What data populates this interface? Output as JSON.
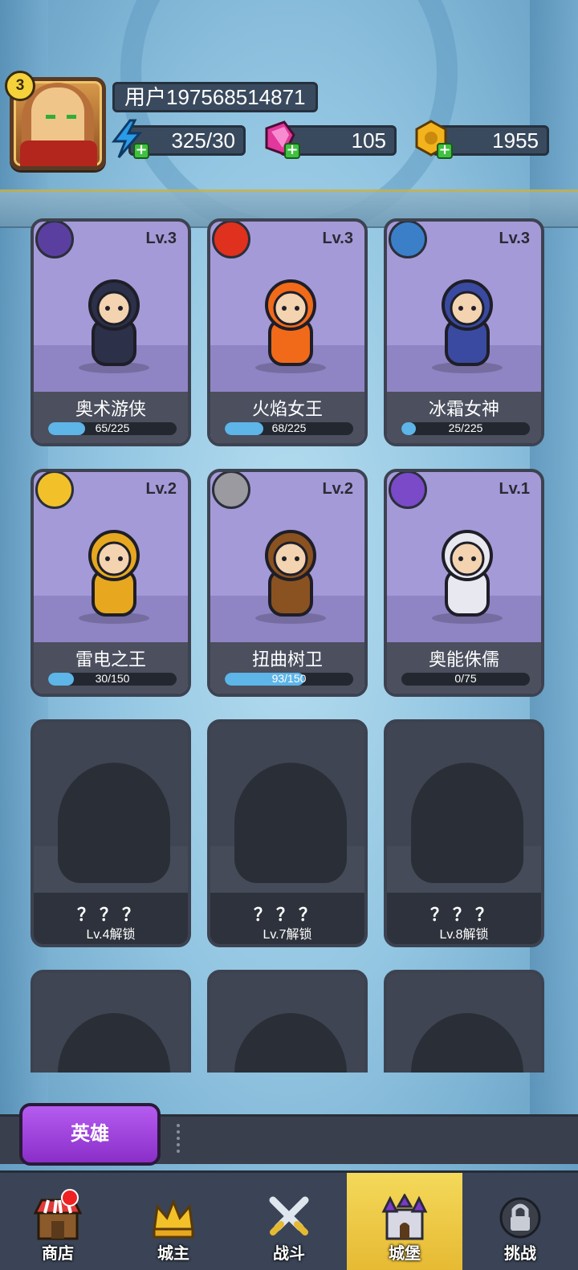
{
  "player": {
    "level": "3",
    "username": "用户197568514871"
  },
  "resources": {
    "energy": "325/30",
    "gems": "105",
    "gold": "1955"
  },
  "heroes": [
    {
      "name": "奥术游侠",
      "level": "Lv.3",
      "progress": "65/225",
      "fraction": 0.289,
      "element_color": "#5b3fa0",
      "body_color": "#2c3048"
    },
    {
      "name": "火焰女王",
      "level": "Lv.3",
      "progress": "68/225",
      "fraction": 0.302,
      "element_color": "#e0301e",
      "body_color": "#f06a1a"
    },
    {
      "name": "冰霜女神",
      "level": "Lv.3",
      "progress": "25/225",
      "fraction": 0.111,
      "element_color": "#3b7fc8",
      "body_color": "#3a4aa0"
    },
    {
      "name": "雷电之王",
      "level": "Lv.2",
      "progress": "30/150",
      "fraction": 0.2,
      "element_color": "#f2c12a",
      "body_color": "#e7a81f"
    },
    {
      "name": "扭曲树卫",
      "level": "Lv.2",
      "progress": "93/150",
      "fraction": 0.62,
      "element_color": "#9a9aa0",
      "body_color": "#8a5220"
    },
    {
      "name": "奥能侏儒",
      "level": "Lv.1",
      "progress": "0/75",
      "fraction": 0.0,
      "element_color": "#7a4ac8",
      "body_color": "#e8e8f0"
    }
  ],
  "locked": [
    {
      "name": "？？？",
      "unlock": "Lv.4解锁"
    },
    {
      "name": "？？？",
      "unlock": "Lv.7解锁"
    },
    {
      "name": "？？？",
      "unlock": "Lv.8解锁"
    }
  ],
  "tabs": {
    "active_tab": "英雄"
  },
  "nav": [
    {
      "label": "商店",
      "icon": "shop-icon",
      "notify": true
    },
    {
      "label": "城主",
      "icon": "crown-icon",
      "notify": false
    },
    {
      "label": "战斗",
      "icon": "crossed-swords-icon",
      "notify": false
    },
    {
      "label": "城堡",
      "icon": "castle-icon",
      "notify": false,
      "active": true
    },
    {
      "label": "挑战",
      "icon": "locked-challenge-icon",
      "notify": false
    }
  ],
  "colors": {
    "accent_purple": "#9b3fd8",
    "active_nav": "#f0cf48",
    "progress": "#5db5e8"
  }
}
